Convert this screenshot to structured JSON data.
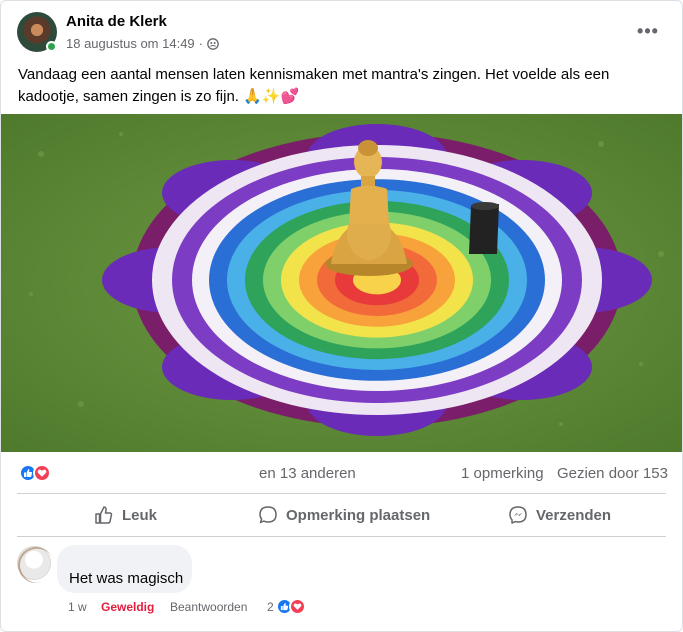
{
  "post": {
    "author": "Anita de Klerk",
    "timestamp": "18 augustus om 14:49",
    "separator": "·",
    "privacy_icon": "friends-icon",
    "more_icon": "more-options-icon",
    "more_label": "•••",
    "text": "Vandaag een aantal mensen laten kennismaken met mantra's zingen. Het voelde als een kadootje, samen zingen is zo fijn. 🙏✨💕"
  },
  "stats": {
    "reaction_icons": [
      "like-icon",
      "love-icon"
    ],
    "names_suffix": "en 13 anderen",
    "comments": "1 opmerking",
    "views": "Gezien door 153"
  },
  "actions": {
    "like": "Leuk",
    "comment": "Opmerking plaatsen",
    "send": "Verzenden"
  },
  "comment": {
    "text": "Het was magisch",
    "time": "1 w",
    "reaction": "Geweldig",
    "reply": "Beantwoorden",
    "reaction_count": "2"
  },
  "colors": {
    "like_blue": "#1877f2",
    "love_red": "#f33e58",
    "reaction_red": "#e41e3f",
    "secondary_text": "#65676b",
    "online_green": "#31a24c"
  }
}
